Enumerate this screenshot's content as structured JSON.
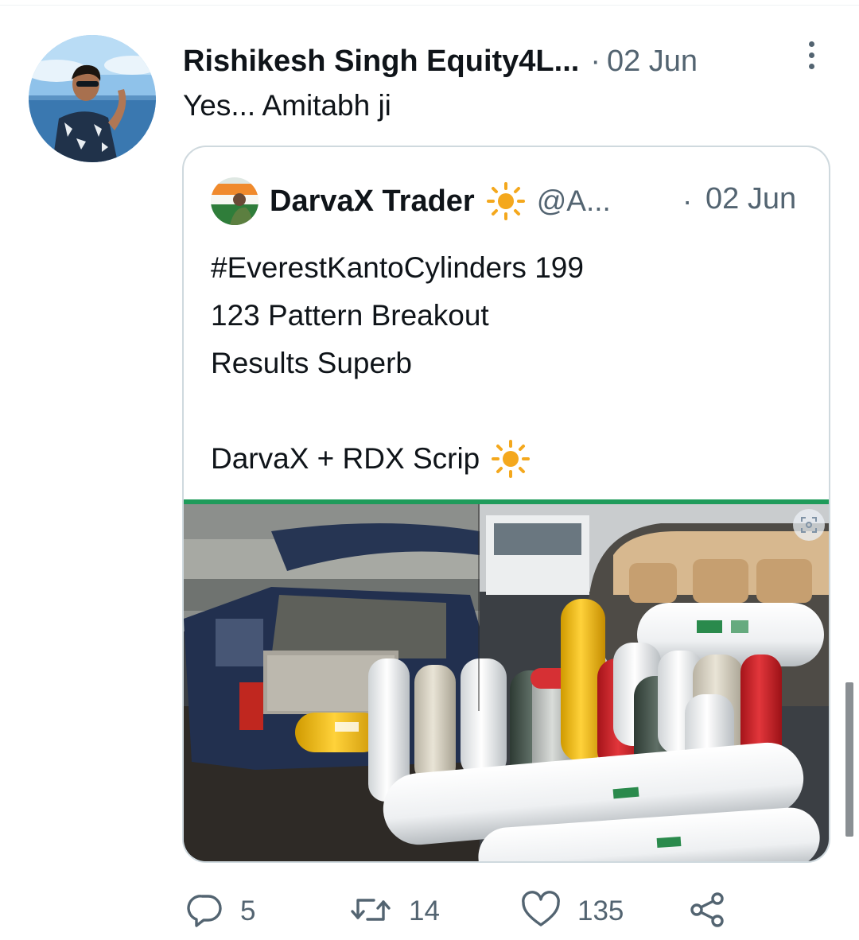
{
  "post": {
    "author_name": "Rishikesh Singh Equity4L...",
    "separator": "·",
    "date": "02 Jun",
    "text": "Yes... Amitabh ji"
  },
  "quoted_post": {
    "author_name": "DarvaX Trader",
    "name_emoji": "sun-icon",
    "handle": "@A...",
    "separator": "·",
    "date": "02 Jun",
    "lines": [
      "#EverestKantoCylinders 199",
      "123 Pattern Breakout",
      "Results Superb",
      "",
      "DarvaX + RDX Scrip"
    ],
    "line_emoji": "sun-icon",
    "media_description_icon": "expand-icon"
  },
  "actions": {
    "reply_count": "5",
    "retweet_count": "14",
    "like_count": "135",
    "icons": [
      "reply-icon",
      "retweet-icon",
      "like-icon",
      "share-icon"
    ]
  },
  "colors": {
    "text_primary": "#0f1419",
    "text_secondary": "#536471",
    "border": "#cfd9de",
    "sun": "#f4a81d",
    "media_top_bar": "#1f9b5b"
  }
}
